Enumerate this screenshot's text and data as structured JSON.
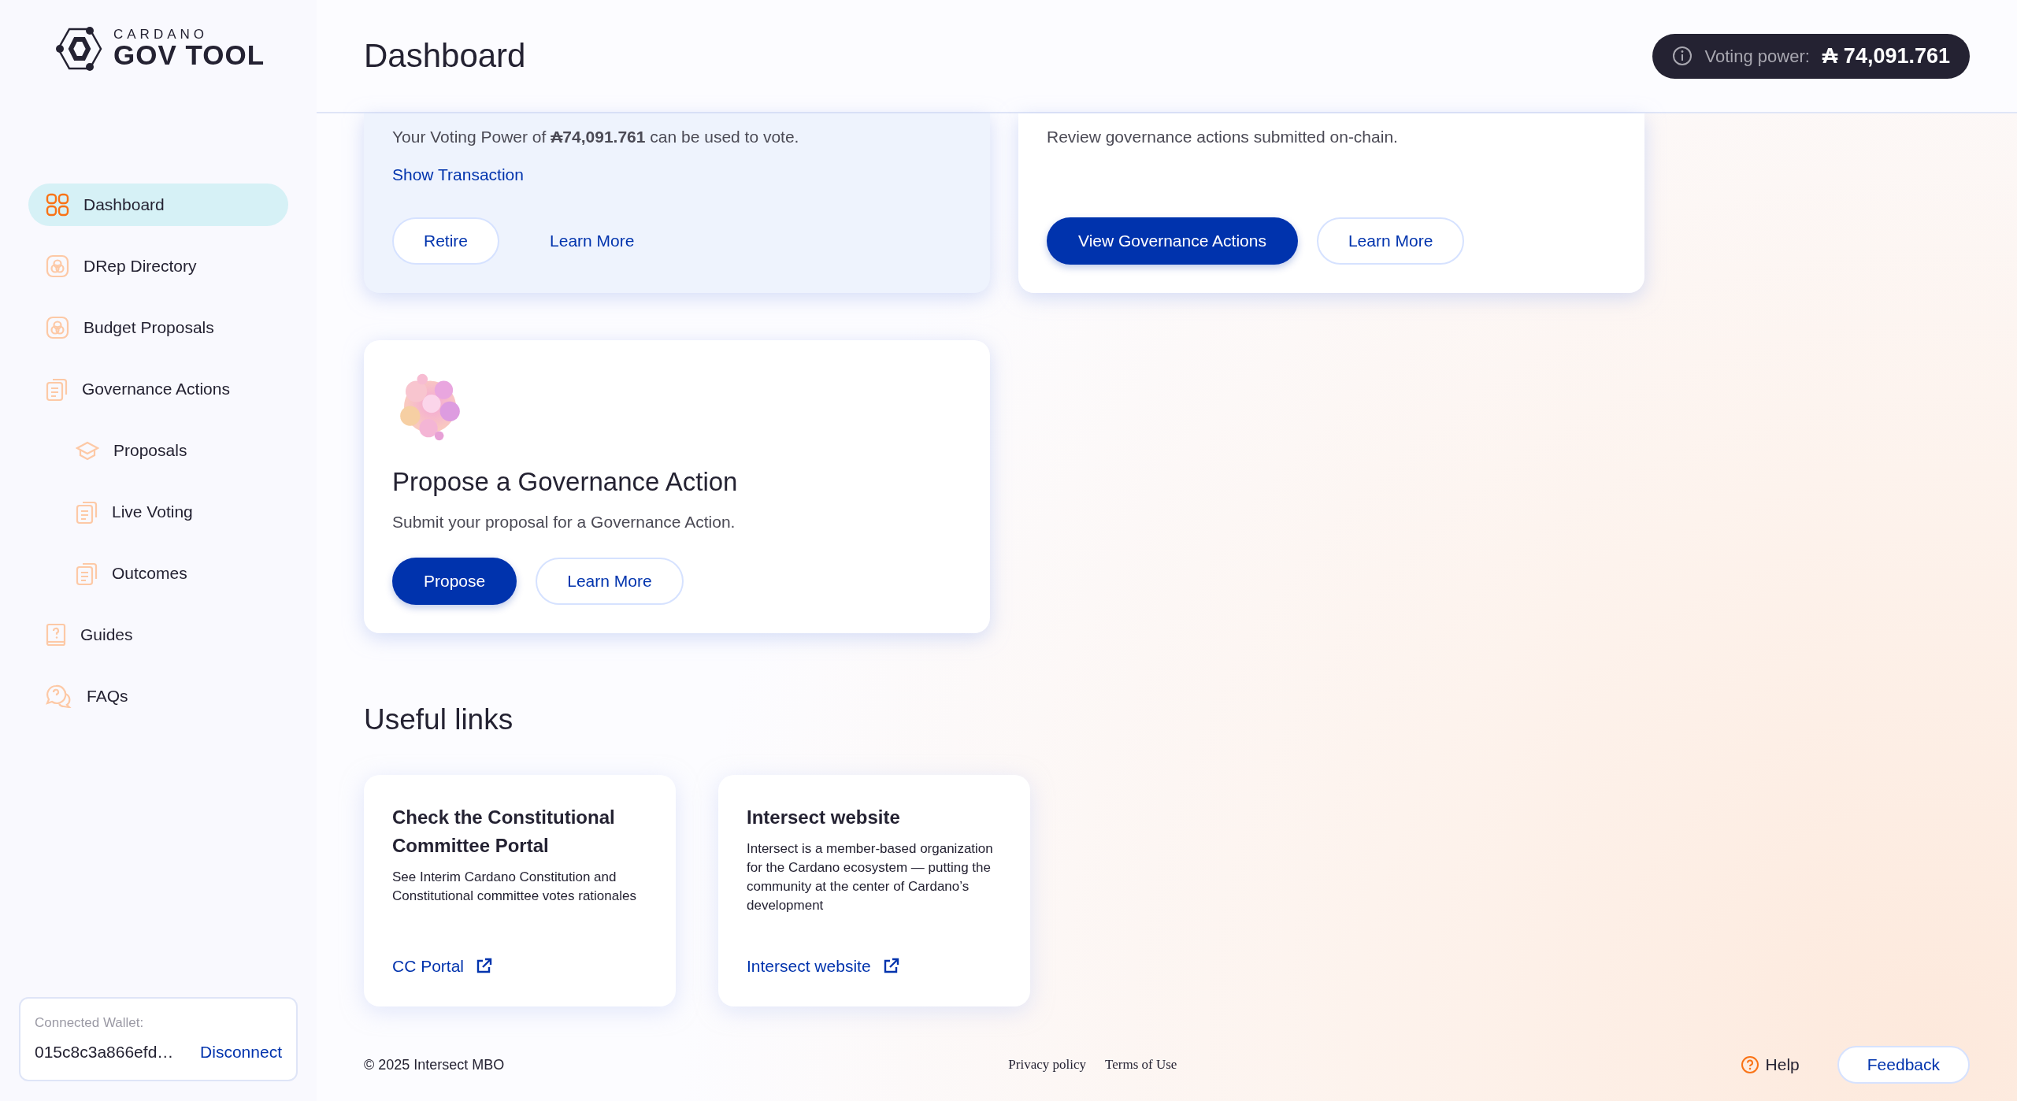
{
  "logo": {
    "top": "CARDANO",
    "bottom": "GOV TOOL"
  },
  "sidebar": {
    "items": [
      {
        "label": "Dashboard",
        "selected": true
      },
      {
        "label": "DRep Directory",
        "selected": false
      },
      {
        "label": "Budget Proposals",
        "selected": false
      },
      {
        "label": "Governance Actions",
        "selected": false,
        "children": [
          {
            "label": "Proposals",
            "selected": false
          },
          {
            "label": "Live Voting",
            "selected": false
          },
          {
            "label": "Outcomes",
            "selected": false
          }
        ]
      },
      {
        "label": "Guides",
        "selected": false
      },
      {
        "label": "FAQs",
        "selected": false
      }
    ]
  },
  "wallet": {
    "label": "Connected Wallet:",
    "address": "015c8c3a866efd…",
    "action": "Disconnect"
  },
  "header": {
    "title": "Dashboard",
    "voting_power": {
      "label": "Voting power:",
      "value": "₳ 74,091.761"
    }
  },
  "cards": [
    {
      "highlighted": true,
      "description": "Your Voting Power of **₳74,091.761** can be used to vote.",
      "link": "Show Transaction",
      "buttons": [
        {
          "label": "Retire",
          "kind": "outline"
        },
        {
          "label": "Learn More",
          "kind": "text"
        }
      ]
    },
    {
      "highlighted": false,
      "description": "Review governance actions submitted on-chain.",
      "buttons": [
        {
          "label": "View Governance Actions",
          "kind": "primary"
        },
        {
          "label": "Learn More",
          "kind": "outline"
        }
      ]
    },
    {
      "highlighted": false,
      "kind": "picture",
      "title": "Propose a Governance Action",
      "description": "Submit your proposal for a Governance Action.",
      "buttons": [
        {
          "label": "Propose",
          "kind": "primary"
        },
        {
          "label": "Learn More",
          "kind": "outline"
        }
      ]
    }
  ],
  "useful_links": {
    "title": "Useful links",
    "items": [
      {
        "title": "Check the Constitutional Committee Portal",
        "description": "See Interim Cardano Constitution and Constitutional committee votes rationales",
        "link": "CC Portal"
      },
      {
        "title": "Intersect website",
        "description": "Intersect is a member-based organization for the Cardano ecosystem — putting the community at the center of Cardano’s development",
        "link": "Intersect website"
      }
    ]
  },
  "footer": {
    "copyright": "© 2025 Intersect MBO",
    "links": [
      "Privacy policy",
      "Terms of Use"
    ],
    "help": "Help",
    "feedback": "Feedback"
  }
}
